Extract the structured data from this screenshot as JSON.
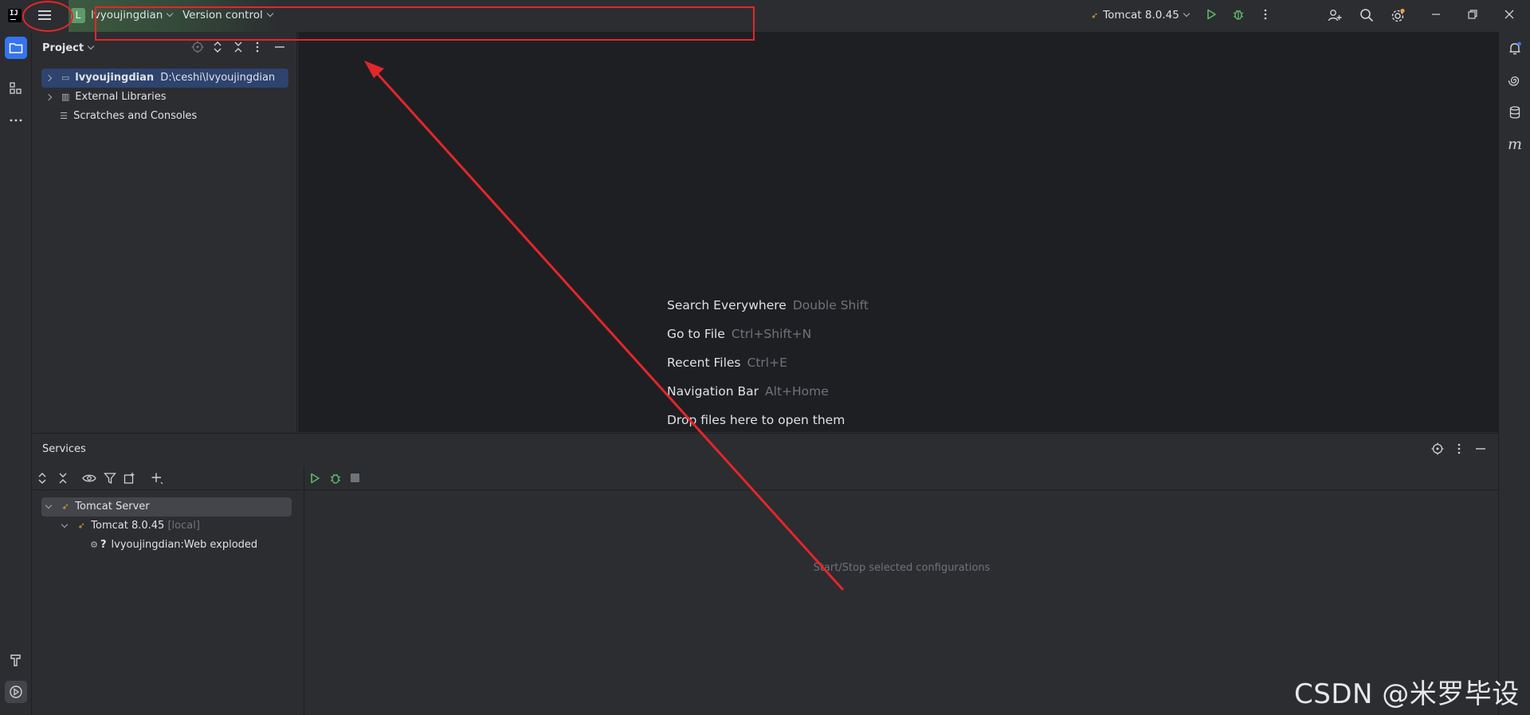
{
  "titlebar": {
    "project_badge": "L",
    "project_name": "lvyoujingdian",
    "vcs_label": "Version control",
    "run_config": "Tomcat 8.0.45"
  },
  "project_panel": {
    "title": "Project",
    "tree": [
      {
        "label": "lvyoujingdian",
        "path": "D:\\ceshi\\lvyoujingdian"
      },
      {
        "label": "External Libraries"
      },
      {
        "label": "Scratches and Consoles"
      }
    ]
  },
  "editor": {
    "hints": [
      {
        "label": "Search Everywhere",
        "shortcut": "Double Shift"
      },
      {
        "label": "Go to File",
        "shortcut": "Ctrl+Shift+N"
      },
      {
        "label": "Recent Files",
        "shortcut": "Ctrl+E"
      },
      {
        "label": "Navigation Bar",
        "shortcut": "Alt+Home"
      },
      {
        "label": "Drop files here to open them",
        "shortcut": ""
      }
    ]
  },
  "services": {
    "title": "Services",
    "tree": [
      {
        "label": "Tomcat Server"
      },
      {
        "label": "Tomcat 8.0.45",
        "suffix": "[local]"
      },
      {
        "label": "lvyoujingdian:Web exploded",
        "status": "?"
      }
    ],
    "empty_text": "Start/Stop selected configurations"
  },
  "watermark": "CSDN @米罗毕设",
  "colors": {
    "accent": "#3574f0",
    "annotation": "#e3262b",
    "run_green": "#5fb865"
  }
}
